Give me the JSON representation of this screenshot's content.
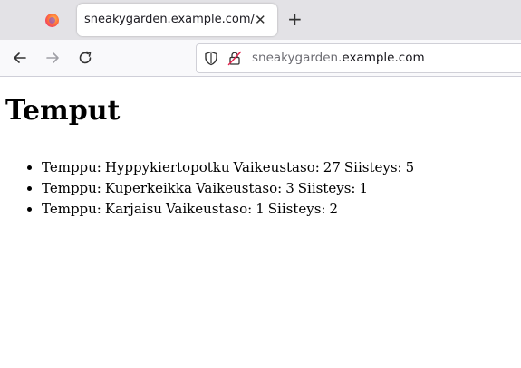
{
  "browser": {
    "tab_title": "sneakygarden.example.com/",
    "tab_close_icon": "close-icon",
    "new_tab_icon": "plus-icon",
    "url_subdomain": "sneakygarden.",
    "url_domain": "example.com"
  },
  "page": {
    "heading": "Temput",
    "items": [
      {
        "trick_label": "Temppu:",
        "trick": "Hyppykiertopotku",
        "difficulty_label": "Vaikeustaso:",
        "difficulty": "27",
        "neatness_label": "Siisteys:",
        "neatness": "5"
      },
      {
        "trick_label": "Temppu:",
        "trick": "Kuperkeikka",
        "difficulty_label": "Vaikeustaso:",
        "difficulty": "3",
        "neatness_label": "Siisteys:",
        "neatness": "1"
      },
      {
        "trick_label": "Temppu:",
        "trick": "Karjaisu",
        "difficulty_label": "Vaikeustaso:",
        "difficulty": "1",
        "neatness_label": "Siisteys:",
        "neatness": "2"
      }
    ]
  }
}
